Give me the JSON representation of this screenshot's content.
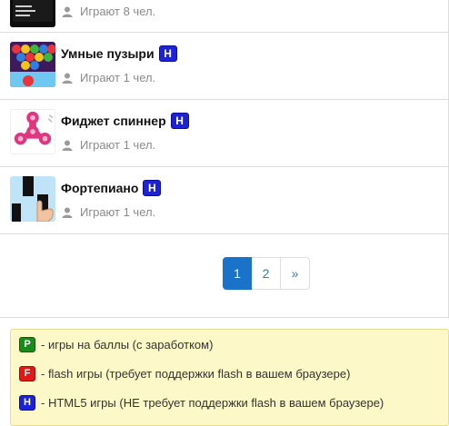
{
  "games": [
    {
      "title": "",
      "players": "Играют 8 чел.",
      "thumb_icon": "dark-game-thumbnail-icon"
    },
    {
      "title": "Умные пузыри",
      "badge": "H",
      "players": "Играют 1 чел.",
      "thumb_icon": "bubbles-thumbnail-icon"
    },
    {
      "title": "Фиджет спиннер",
      "badge": "H",
      "players": "Играют 1 чел.",
      "thumb_icon": "fidget-spinner-thumbnail-icon"
    },
    {
      "title": "Фортепиано",
      "badge": "H",
      "players": "Играют 1 чел.",
      "thumb_icon": "piano-tiles-thumbnail-icon"
    }
  ],
  "pagination": {
    "pages": [
      "1",
      "2"
    ],
    "next": "»",
    "active": "1"
  },
  "legend": {
    "points": {
      "badge": "P",
      "text": "- игры на баллы (с заработком)"
    },
    "flash": {
      "badge": "F",
      "text": "- flash игры (требует поддержки flash в вашем браузере)"
    },
    "html5": {
      "badge": "H",
      "text": "- HTML5 игры (НЕ требует поддержки flash в вашем браузере)"
    }
  },
  "colors": {
    "badge_html5": "#1e22d6",
    "badge_flash": "#e01818",
    "badge_points": "#1a8a1a",
    "pager_active": "#1a73c8",
    "legend_bg": "#fcf8c7"
  }
}
